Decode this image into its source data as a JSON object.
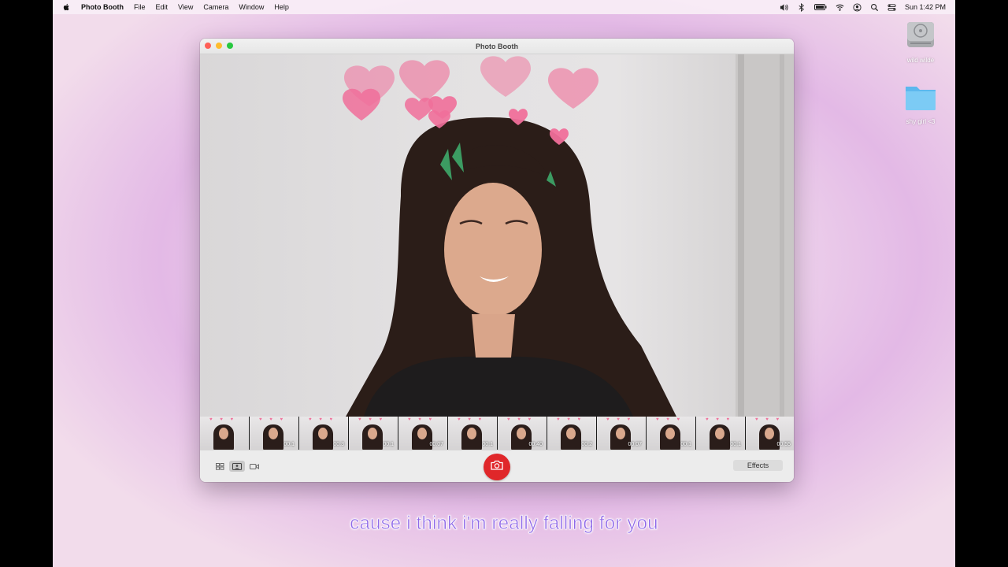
{
  "menubar": {
    "apple_icon": "apple-icon",
    "app_name": "Photo Booth",
    "items": [
      "File",
      "Edit",
      "View",
      "Camera",
      "Window",
      "Help"
    ],
    "status_icons": [
      "volume-icon",
      "bluetooth-icon",
      "battery-icon",
      "wifi-icon",
      "user-icon",
      "search-icon",
      "control-center-icon"
    ],
    "clock": "Sun 1:42 PM"
  },
  "desktop": {
    "icons": [
      {
        "label": "wild wilde",
        "icon": "disk-icon"
      },
      {
        "label": "shy girl <3",
        "icon": "folder-icon"
      }
    ]
  },
  "window": {
    "title": "Photo Booth",
    "filmstrip": [
      {
        "time": ""
      },
      {
        "time": "00:1"
      },
      {
        "time": "00:3"
      },
      {
        "time": "00:1"
      },
      {
        "time": "00:07"
      },
      {
        "time": "00:1"
      },
      {
        "time": "00:40"
      },
      {
        "time": "00:2"
      },
      {
        "time": "00:07"
      },
      {
        "time": "00:1"
      },
      {
        "time": "00:1"
      },
      {
        "time": "00:55"
      }
    ],
    "toolbar": {
      "view_icons": [
        "grid-view-icon",
        "single-photo-icon",
        "video-icon"
      ],
      "shutter_icon": "camera-icon",
      "effects_label": "Effects"
    }
  },
  "subtitle": "cause i think i'm really falling for you",
  "colors": {
    "shutter": "#e0272a",
    "subtitle": "#8f68e8",
    "hearts": "#f06f9a"
  }
}
